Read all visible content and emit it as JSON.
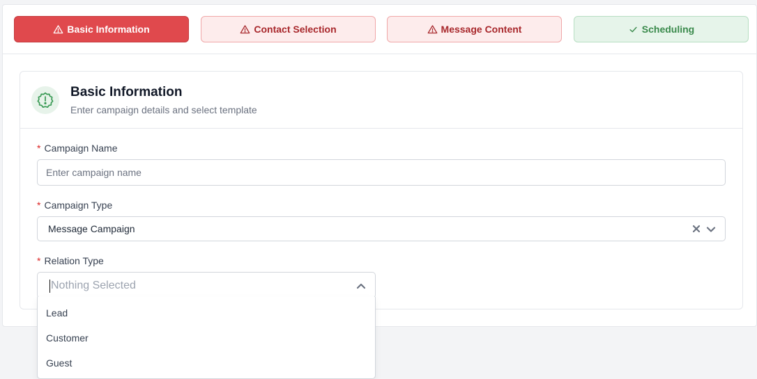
{
  "steps": [
    {
      "label": "Basic Information",
      "state": "error-active",
      "icon": "warning-icon"
    },
    {
      "label": "Contact Selection",
      "state": "error",
      "icon": "warning-icon"
    },
    {
      "label": "Message Content",
      "state": "error",
      "icon": "warning-icon"
    },
    {
      "label": "Scheduling",
      "state": "success",
      "icon": "check-icon"
    }
  ],
  "section": {
    "title": "Basic Information",
    "subtitle": "Enter campaign details and select template",
    "icon": "alert-badge-icon"
  },
  "fields": {
    "campaign_name": {
      "required_mark": "*",
      "label": "Campaign Name",
      "placeholder": "Enter campaign name",
      "value": ""
    },
    "campaign_type": {
      "required_mark": "*",
      "label": "Campaign Type",
      "value": "Message Campaign"
    },
    "relation_type": {
      "required_mark": "*",
      "label": "Relation Type",
      "placeholder": "Nothing Selected",
      "options": [
        "Lead",
        "Customer",
        "Guest"
      ]
    }
  },
  "colors": {
    "error_active_bg": "#e0494d",
    "error_bg": "#fdecec",
    "error_text": "#a8282c",
    "success_bg": "#e6f4ea",
    "success_text": "#3a8a4c",
    "required": "#dc2626"
  }
}
